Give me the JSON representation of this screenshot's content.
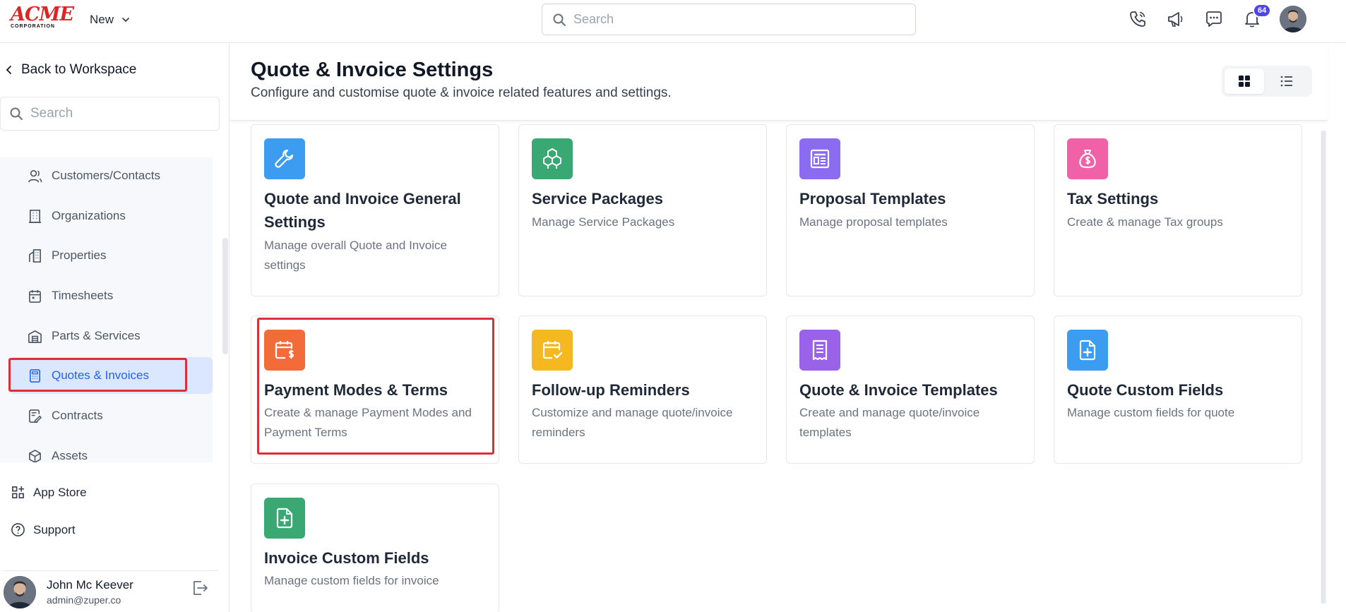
{
  "topbar": {
    "logo_word": "ACME",
    "logo_sub": "CORPORATION",
    "new_label": "New",
    "search_placeholder": "Search",
    "notification_count": "64"
  },
  "sidebar": {
    "back_label": "Back to Workspace",
    "search_placeholder": "Search",
    "items": [
      {
        "label": "Customers/Contacts",
        "icon": "users-icon"
      },
      {
        "label": "Organizations",
        "icon": "building-icon"
      },
      {
        "label": "Properties",
        "icon": "property-icon"
      },
      {
        "label": "Timesheets",
        "icon": "calendar-icon"
      },
      {
        "label": "Parts & Services",
        "icon": "warehouse-icon"
      },
      {
        "label": "Quotes & Invoices",
        "icon": "calculator-icon",
        "active": true
      },
      {
        "label": "Contracts",
        "icon": "contract-icon"
      },
      {
        "label": "Assets",
        "icon": "cube-icon"
      }
    ],
    "app_store_label": "App Store",
    "support_label": "Support",
    "user": {
      "name": "John Mc Keever",
      "email": "admin@zuper.co"
    }
  },
  "header": {
    "title": "Quote & Invoice Settings",
    "subtitle": "Configure and customise quote & invoice related features and settings."
  },
  "cards": [
    {
      "title": "Quote and Invoice General Settings",
      "desc": "Manage overall Quote and Invoice settings",
      "color": "#3b9cf0",
      "icon": "wrench-icon"
    },
    {
      "title": "Service Packages",
      "desc": "Manage Service Packages",
      "color": "#3aa872",
      "icon": "boxes-icon"
    },
    {
      "title": "Proposal Templates",
      "desc": "Manage proposal templates",
      "color": "#8b6cf0",
      "icon": "template-icon"
    },
    {
      "title": "Tax Settings",
      "desc": "Create & manage Tax groups",
      "color": "#f061a8",
      "icon": "money-bag-icon"
    },
    {
      "title": "Payment Modes & Terms",
      "desc": "Create & manage Payment Modes and Payment Terms",
      "color": "#f46b3a",
      "icon": "calendar-dollar-icon"
    },
    {
      "title": "Follow-up Reminders",
      "desc": "Customize and manage quote/invoice reminders",
      "color": "#f5b820",
      "icon": "calendar-check-icon"
    },
    {
      "title": "Quote & Invoice Templates",
      "desc": "Create and manage quote/invoice templates",
      "color": "#9a62e8",
      "icon": "receipt-icon"
    },
    {
      "title": "Quote Custom Fields",
      "desc": "Manage custom fields for quote",
      "color": "#3b9cf0",
      "icon": "file-plus-icon"
    },
    {
      "title": "Invoice Custom Fields",
      "desc": "Manage custom fields for invoice",
      "color": "#3aa872",
      "icon": "file-plus-icon"
    }
  ]
}
